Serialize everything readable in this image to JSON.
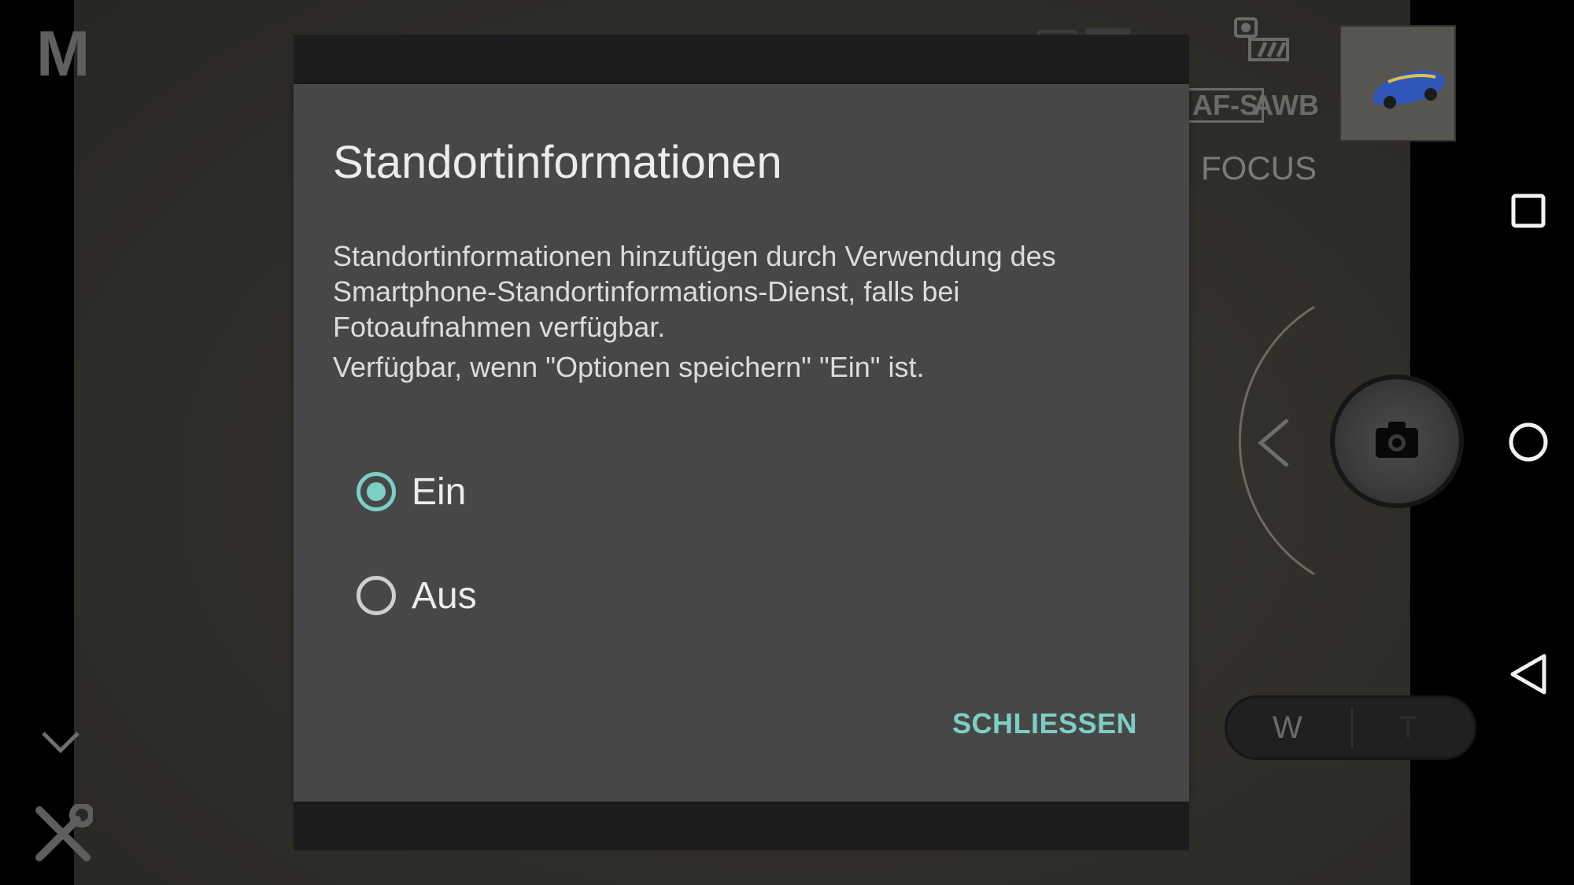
{
  "camera": {
    "mode": "M",
    "focus_mode": "AF-S",
    "white_balance": "AWB",
    "focus_label": "FOCUS",
    "zoom_wide": "W",
    "zoom_tele": "T"
  },
  "dialog": {
    "title": "Standortinformationen",
    "body_line1": "Standortinformationen hinzufügen durch Verwendung des Smartphone-Standortinformations-Dienst, falls bei Fotoaufnahmen verfügbar.",
    "body_line2": "Verfügbar, wenn \"Optionen speichern\" \"Ein\" ist.",
    "options": [
      {
        "label": "Ein",
        "selected": true
      },
      {
        "label": "Aus",
        "selected": false
      }
    ],
    "close_label": "SCHLIESSEN"
  },
  "colors": {
    "accent": "#7ccfc5",
    "dialog_bg": "#474747",
    "frame_bg": "#1d1d1d"
  },
  "icons": {
    "nav": [
      "recents-icon",
      "home-icon",
      "back-icon"
    ],
    "camera": [
      "shutter-camera-icon",
      "tools-icon",
      "chevron-down-icon",
      "chevron-left-icon"
    ]
  }
}
